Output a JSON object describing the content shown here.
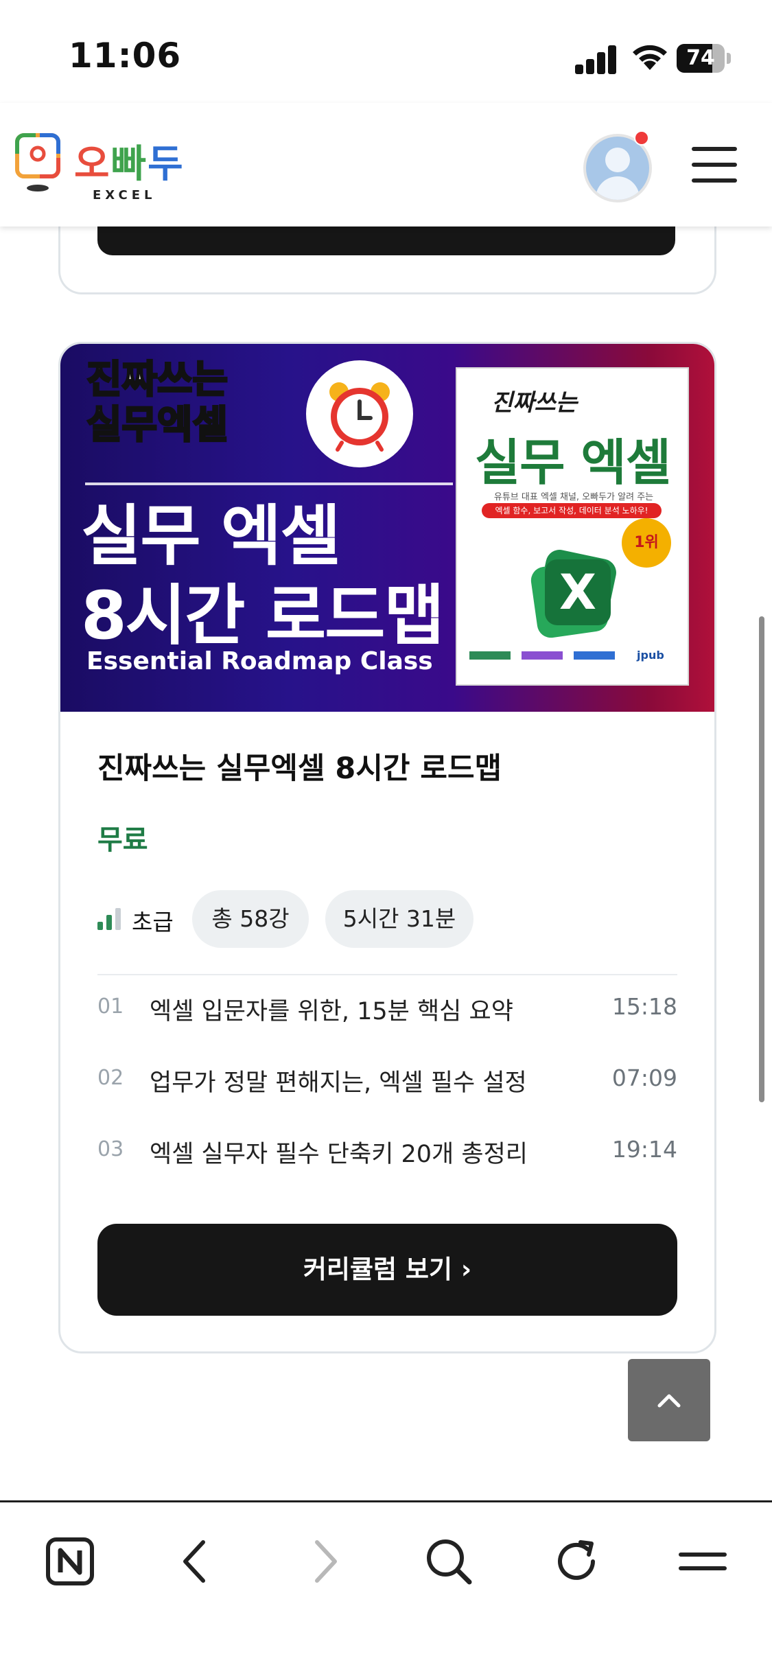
{
  "status_bar": {
    "time": "11:06",
    "battery": "74",
    "battery_level": 0.74
  },
  "header": {
    "logo_text": [
      "오",
      "빠",
      "두"
    ],
    "logo_sub": "EXCEL",
    "avatar_has_notification": true
  },
  "course": {
    "banner": {
      "tag_line1": "진짜쓰는",
      "tag_line2": "실무엑셀",
      "title_line1": "실무 엑셀",
      "title_line2": "8시간 로드맵",
      "subtitle": "Essential Roadmap Class",
      "book": {
        "top": "진짜쓰는",
        "title": "실무 엑셀",
        "desc": "유튜브 대표 엑셀 채널, 오빠두가 알려 주는",
        "pill": "엑셀 함수, 보고서 작성, 데이터 분석 노하우!",
        "badge": "1위",
        "publisher": "jpub"
      }
    },
    "title": "진짜쓰는 실무엑셀 8시간 로드맵",
    "price": "무료",
    "level": "초급",
    "lectures": "총 58강",
    "duration": "5시간 31분",
    "lessons": [
      {
        "num": "01",
        "name": "엑셀 입문자를 위한, 15분 핵심 요약",
        "dur": "15:18"
      },
      {
        "num": "02",
        "name": "업무가 정말 편해지는, 엑셀 필수 설정",
        "dur": "07:09"
      },
      {
        "num": "03",
        "name": "엑셀 실무자 필수 단축키 20개 총정리",
        "dur": "19:14"
      }
    ],
    "cta": "커리큘럼 보기 ›"
  },
  "colors": {
    "accent_green": "#1e7b45",
    "dark_button": "#161616",
    "chip_bg": "#edf0f2",
    "notification": "#ef3a3a"
  },
  "icons": {
    "bottom_bar": [
      "naver-n-icon",
      "back-icon",
      "forward-icon",
      "search-icon",
      "refresh-icon",
      "menu-icon"
    ],
    "scroll_top": "chevron-up-icon"
  }
}
